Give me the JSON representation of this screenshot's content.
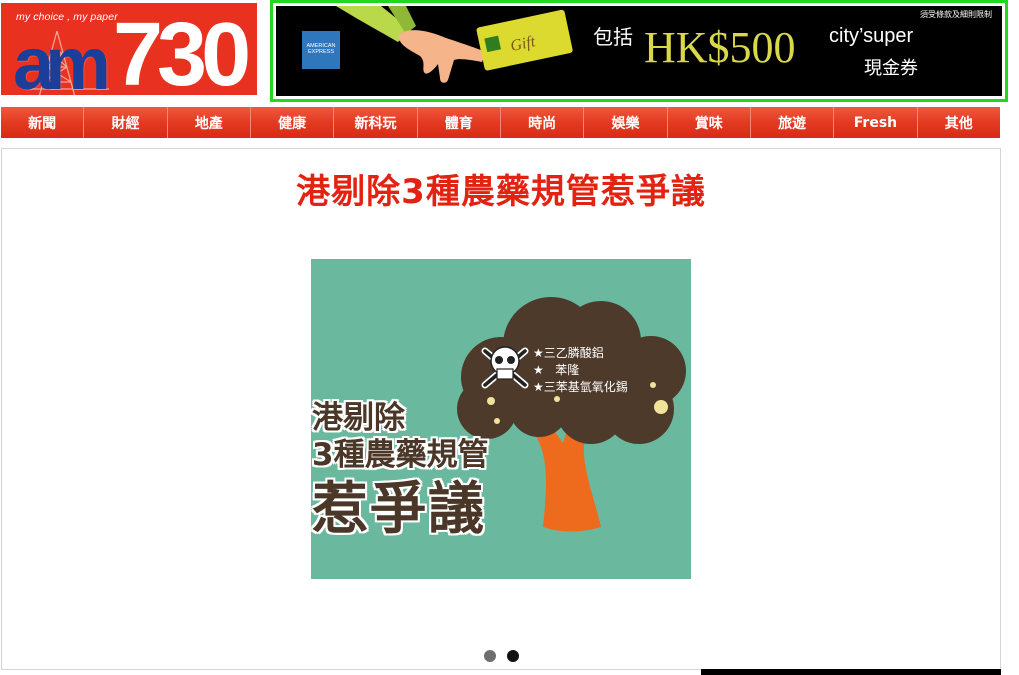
{
  "logo": {
    "tagline": "my choice , my paper",
    "brand_prefix": "am",
    "brand_number": "730"
  },
  "ad": {
    "terms": "須受條款及細則限制",
    "include_text": "包括",
    "amount": "HK$500",
    "brand": "city’super",
    "voucher": "現金券",
    "card_label": "AMERICAN EXPRESS",
    "gift_label": "Gift",
    "border_color": "#22d81e"
  },
  "nav": {
    "items": [
      {
        "label": "新聞"
      },
      {
        "label": "財經"
      },
      {
        "label": "地產"
      },
      {
        "label": "健康"
      },
      {
        "label": "新科玩"
      },
      {
        "label": "體育"
      },
      {
        "label": "時尚"
      },
      {
        "label": "娛樂"
      },
      {
        "label": "賞味"
      },
      {
        "label": "旅遊"
      },
      {
        "label": "Fresh"
      },
      {
        "label": "其他"
      }
    ],
    "color": "#e33a22"
  },
  "slide": {
    "headline": "港剔除3種農藥規管惹爭議",
    "headline_color": "#e32312",
    "image": {
      "title_line1": "港剔除",
      "title_line2": "3種農藥規管",
      "title_line3": "惹爭議",
      "pesticides": [
        "★三乙膦酸鋁",
        "★   苯隆",
        "★三苯基氫氧化錫"
      ],
      "icon": "skull-crossbones-icon",
      "background": "#6ab99e"
    },
    "pagination": {
      "total": 2,
      "active": 2
    }
  }
}
